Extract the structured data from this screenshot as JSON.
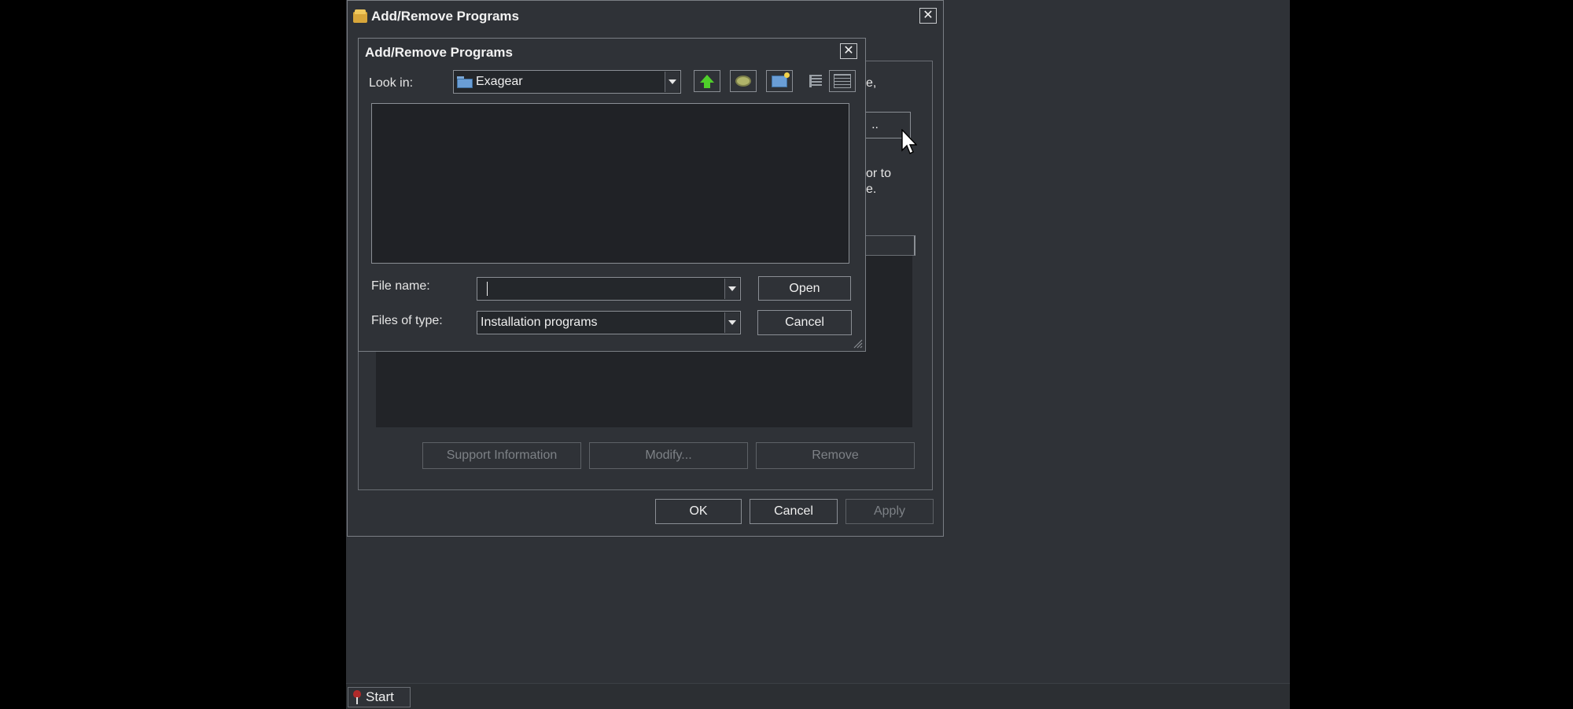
{
  "taskbar": {
    "start_label": "Start"
  },
  "main_window": {
    "title": "Add/Remove Programs",
    "close_symbol": "✕",
    "partial_text_1": "e,",
    "partial_button": "..",
    "partial_text_2": "or to",
    "partial_text_3": "e.",
    "buttons": {
      "support": "Support Information",
      "modify": "Modify...",
      "remove": "Remove",
      "ok": "OK",
      "cancel": "Cancel",
      "apply": "Apply"
    }
  },
  "open_dialog": {
    "title": "Add/Remove Programs",
    "close_symbol": "✕",
    "look_in_label": "Look in:",
    "look_in_value": "Exagear",
    "file_name_label": "File name:",
    "file_name_value": "",
    "files_of_type_label": "Files of type:",
    "files_of_type_value": "Installation programs",
    "open_label": "Open",
    "cancel_label": "Cancel",
    "toolbar_icons": [
      "up-folder-icon",
      "desktop-icon",
      "new-folder-icon",
      "list-view-icon",
      "details-view-icon"
    ]
  }
}
